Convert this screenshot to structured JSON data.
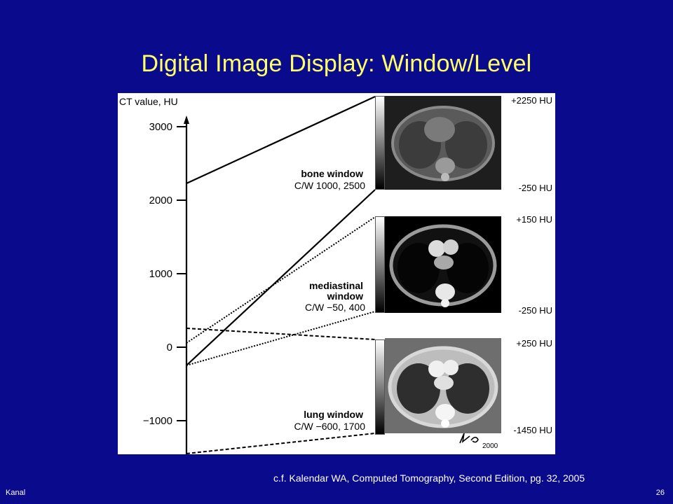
{
  "slide": {
    "title": "Digital Image Display: Window/Level",
    "citation": "c.f. Kalendar WA, Computed Tomography, Second Edition, pg. 32, 2005",
    "footer_left": "Kanal",
    "page_number": "26"
  },
  "figure": {
    "axis_label": "CT value, HU",
    "ticks": [
      "3000",
      "2000",
      "1000",
      "0",
      "−1000"
    ],
    "signature": "Ka 2000",
    "windows": [
      {
        "name": "bone window",
        "cw": "C/W 1000, 2500",
        "top_hu": "+2250 HU",
        "bottom_hu": "-250 HU"
      },
      {
        "name_line1": "mediastinal",
        "name_line2": "window",
        "cw": "C/W −50, 400",
        "top_hu": "+150 HU",
        "bottom_hu": "-250 HU"
      },
      {
        "name": "lung window",
        "cw": "C/W −600, 1700",
        "top_hu": "+250 HU",
        "bottom_hu": "-1450 HU"
      }
    ]
  },
  "colors": {
    "background": "#0a0a8c",
    "title": "#ffff66"
  }
}
